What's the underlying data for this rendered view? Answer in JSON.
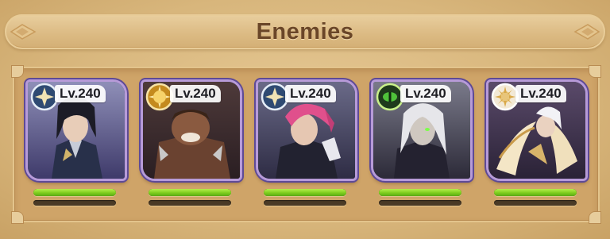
{
  "header": {
    "title": "Enemies"
  },
  "colors": {
    "hp": "#7dcd1e",
    "card_border": "#b79bd8",
    "banner_text": "#6a4628"
  },
  "enemies": [
    {
      "level": "Lv.240",
      "faction": "lightbearer",
      "faction_icon": "compass-star-icon",
      "hp": 1.0,
      "energy": 0.0
    },
    {
      "level": "Lv.240",
      "faction": "mauler",
      "faction_icon": "sunburst-shield-icon",
      "hp": 1.0,
      "energy": 0.0
    },
    {
      "level": "Lv.240",
      "faction": "lightbearer",
      "faction_icon": "compass-star-icon",
      "hp": 1.0,
      "energy": 0.0
    },
    {
      "level": "Lv.240",
      "faction": "graveborn",
      "faction_icon": "green-eye-icon",
      "hp": 1.0,
      "energy": 0.0
    },
    {
      "level": "Lv.240",
      "faction": "celestial",
      "faction_icon": "white-sun-icon",
      "hp": 1.0,
      "energy": 0.0
    }
  ]
}
